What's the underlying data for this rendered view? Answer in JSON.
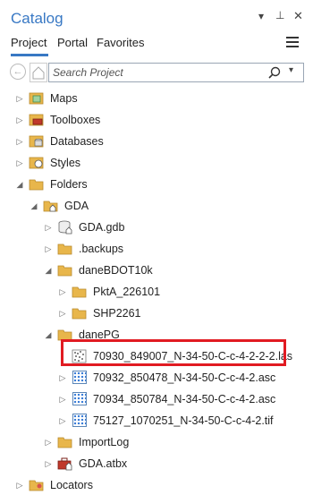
{
  "window": {
    "title": "Catalog"
  },
  "title_controls": {
    "menu": "▾",
    "pin": "⊥",
    "close": "✕"
  },
  "tabs": [
    {
      "label": "Project",
      "active": true
    },
    {
      "label": "Portal",
      "active": false
    },
    {
      "label": "Favorites",
      "active": false
    }
  ],
  "search": {
    "placeholder": "Search Project",
    "dropdown": "▾"
  },
  "tree": {
    "maps": "Maps",
    "toolboxes": "Toolboxes",
    "databases": "Databases",
    "styles": "Styles",
    "folders": "Folders",
    "gda": "GDA",
    "gda_gdb": "GDA.gdb",
    "backups": ".backups",
    "dane_bdot10k": "daneBDOT10k",
    "pkta": "PktA_226101",
    "shp": "SHP2261",
    "dane_pg": "danePG",
    "las_file": "70930_849007_N-34-50-C-c-4-2-2-2.las",
    "asc_1": "70932_850478_N-34-50-C-c-4-2.asc",
    "asc_2": "70934_850784_N-34-50-C-c-4-2.asc",
    "tif_1": "75127_1070251_N-34-50-C-c-4-2.tif",
    "import_log": "ImportLog",
    "gda_atbx": "GDA.atbx",
    "locators": "Locators"
  },
  "colors": {
    "accent": "#3878c4",
    "highlight": "#e11b22",
    "folder": "#e8b64b"
  }
}
